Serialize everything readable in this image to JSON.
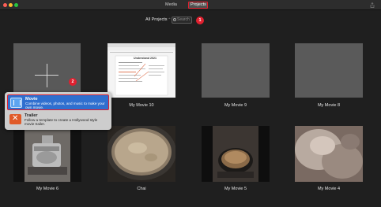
{
  "window": {
    "tabs": {
      "media": "Media",
      "projects": "Projects"
    }
  },
  "toolbar": {
    "filter_label": "All Projects",
    "filter_chevron": "⌃",
    "search_placeholder": "Search",
    "annotation_1": "1"
  },
  "new_project": {
    "annotation_2": "2",
    "menu": [
      {
        "title": "Movie",
        "description": "Combine videos, photos, and music to make your own movie."
      },
      {
        "title": "Trailer",
        "description": "Follow a template to create a Hollywood style movie trailer."
      }
    ]
  },
  "projects_row1": [
    {
      "name": "My Movie 10"
    },
    {
      "name": "My Movie 9"
    },
    {
      "name": "My Movie 8"
    }
  ],
  "projects_row2": [
    {
      "name": "My Movie 6"
    },
    {
      "name": "Chai"
    },
    {
      "name": "My Movie 5"
    },
    {
      "name": "My Movie 4"
    }
  ],
  "thumb10": {
    "doc_heading": "Understand 2021"
  },
  "colors": {
    "annotation": "#e0202f",
    "selection": "#2f6fcf",
    "background": "#1f1f1f"
  }
}
